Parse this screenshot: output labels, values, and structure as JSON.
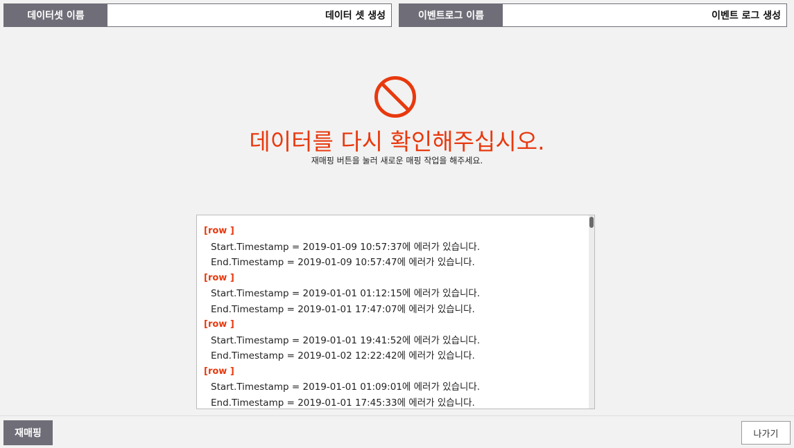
{
  "dataset": {
    "label": "데이터셋 이름",
    "value": "데이터 셋 생성"
  },
  "eventlog": {
    "label": "이벤트로그 이름",
    "value": "이벤트 로그 생성"
  },
  "message": {
    "icon": "ban-icon",
    "title": "데이터를 다시 확인해주십시오.",
    "subtitle": "재매핑 버튼을 눌러 새로운 매핑 작업을 해주세요."
  },
  "errors": [
    {
      "tag": "[row ]",
      "lines": [
        "Start.Timestamp = 2019-01-09 10:57:37에 에러가 있습니다.",
        "End.Timestamp = 2019-01-09 10:57:47에 에러가 있습니다."
      ]
    },
    {
      "tag": "[row ]",
      "lines": [
        "Start.Timestamp = 2019-01-01 01:12:15에 에러가 있습니다.",
        "End.Timestamp = 2019-01-01 17:47:07에 에러가 있습니다."
      ]
    },
    {
      "tag": "[row ]",
      "lines": [
        "Start.Timestamp = 2019-01-01 19:41:52에 에러가 있습니다.",
        "End.Timestamp = 2019-01-02 12:22:42에 에러가 있습니다."
      ]
    },
    {
      "tag": "[row ]",
      "lines": [
        "Start.Timestamp = 2019-01-01 01:09:01에 에러가 있습니다.",
        "End.Timestamp = 2019-01-01 17:45:33에 에러가 있습니다."
      ]
    }
  ],
  "footer": {
    "remap_label": "재매핑",
    "exit_label": "나가기"
  },
  "colors": {
    "accent": "#e8390e",
    "label_bg": "#6f6e78"
  }
}
